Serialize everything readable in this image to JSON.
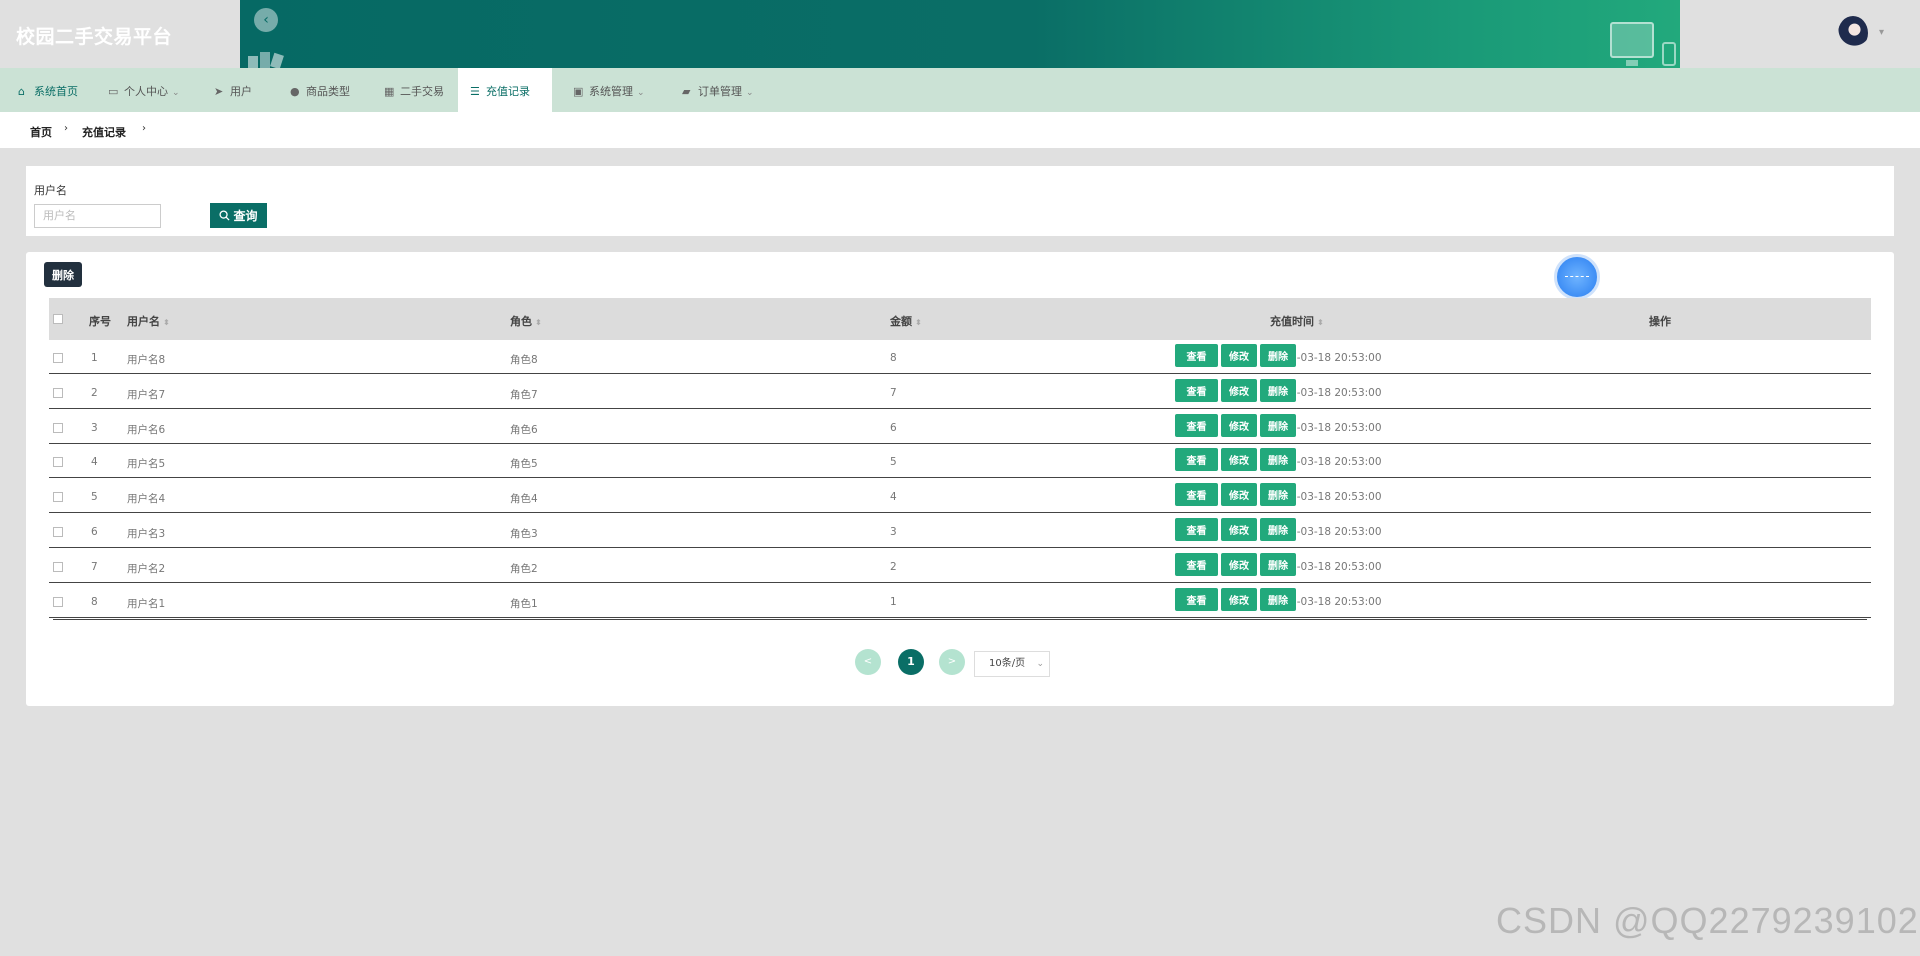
{
  "app": {
    "title": "校园二手交易平台"
  },
  "header": {
    "back_icon": "chevron-left-icon",
    "avatar_caret": "▾"
  },
  "nav": {
    "items": [
      {
        "label": "系统首页",
        "icon": "home-icon",
        "glyph": "⌂",
        "caret": ""
      },
      {
        "label": "个人中心",
        "icon": "card-icon",
        "glyph": "▭",
        "caret": "⌄"
      },
      {
        "label": "用户",
        "icon": "send-icon",
        "glyph": "➤",
        "caret": ""
      },
      {
        "label": "商品类型",
        "icon": "user-icon",
        "glyph": "●",
        "caret": ""
      },
      {
        "label": "二手交易",
        "icon": "grid-icon",
        "glyph": "▦",
        "caret": ""
      },
      {
        "label": "充值记录",
        "icon": "list-icon",
        "glyph": "☰",
        "caret": ""
      },
      {
        "label": "系统管理",
        "icon": "clipboard-icon",
        "glyph": "▣",
        "caret": "⌄"
      },
      {
        "label": "订单管理",
        "icon": "cart-icon",
        "glyph": "▰",
        "caret": "⌄"
      }
    ],
    "active": "充值记录"
  },
  "breadcrumb": [
    "首页",
    "充值记录"
  ],
  "search": {
    "label": "用户名",
    "placeholder": "用户名",
    "value": "",
    "button_label": "查询"
  },
  "toolbar": {
    "delete_label": "删除"
  },
  "table": {
    "columns": [
      "序号",
      "用户名",
      "角色",
      "金额",
      "充值时间",
      "操作"
    ],
    "rows": [
      {
        "index": "1",
        "username": "用户名8",
        "role": "角色8",
        "amount": "8",
        "time": "2025-03-18 20:53:00"
      },
      {
        "index": "2",
        "username": "用户名7",
        "role": "角色7",
        "amount": "7",
        "time": "2025-03-18 20:53:00"
      },
      {
        "index": "3",
        "username": "用户名6",
        "role": "角色6",
        "amount": "6",
        "time": "2025-03-18 20:53:00"
      },
      {
        "index": "4",
        "username": "用户名5",
        "role": "角色5",
        "amount": "5",
        "time": "2025-03-18 20:53:00"
      },
      {
        "index": "5",
        "username": "用户名4",
        "role": "角色4",
        "amount": "4",
        "time": "2025-03-18 20:53:00"
      },
      {
        "index": "6",
        "username": "用户名3",
        "role": "角色3",
        "amount": "3",
        "time": "2025-03-18 20:53:00"
      },
      {
        "index": "7",
        "username": "用户名2",
        "role": "角色2",
        "amount": "2",
        "time": "2025-03-18 20:53:00"
      },
      {
        "index": "8",
        "username": "用户名1",
        "role": "角色1",
        "amount": "1",
        "time": "2025-03-18 20:53:00"
      }
    ],
    "actions": {
      "view": "查看",
      "edit": "修改",
      "delete": "删除"
    }
  },
  "pagination": {
    "prev": "<",
    "current": "1",
    "next": ">",
    "page_size": "10条/页"
  },
  "watermark": "CSDN @QQ2279239102",
  "colors": {
    "primary": "#0a6e66",
    "action": "#22a97c",
    "nav_bg": "#cbe2d5",
    "dark_button": "#22303e"
  }
}
